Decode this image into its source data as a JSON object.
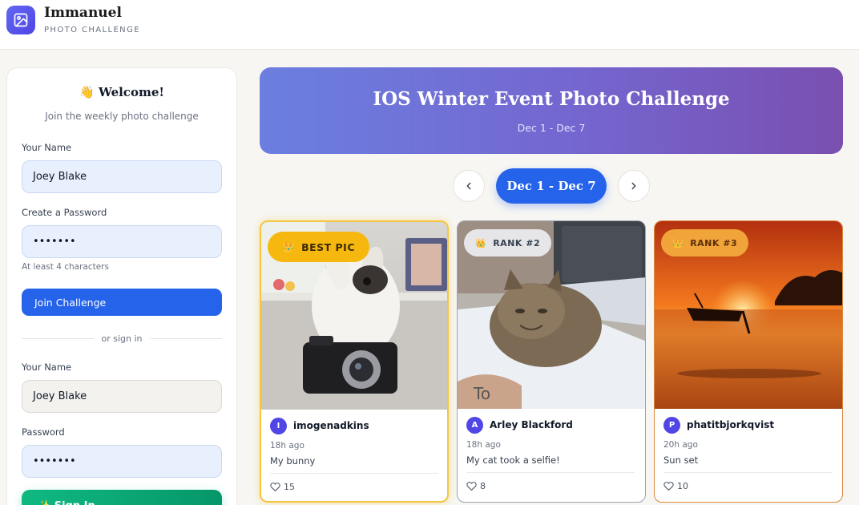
{
  "header": {
    "title": "Immanuel",
    "subtitle": "PHOTO CHALLENGE",
    "logo_icon": "image-icon"
  },
  "sidebar": {
    "welcome": "👋 Welcome!",
    "welcome_sub": "Join the weekly photo challenge",
    "join": {
      "name_label": "Your Name",
      "name_value": "Joey Blake",
      "password_label": "Create a Password",
      "password_value": "•••••••",
      "hint": "At least 4 characters",
      "button": "Join Challenge"
    },
    "divider": "or sign in",
    "signin": {
      "name_label": "Your Name",
      "name_value": "Joey Blake",
      "password_label": "Password",
      "password_value": "•••••••",
      "button": "✨ Sign In"
    }
  },
  "banner": {
    "title": "IOS Winter Event Photo Challenge",
    "dates": "Dec 1 - Dec 7"
  },
  "week_nav": {
    "current": "Dec 1 - Dec 7",
    "prev_icon": "chevron-left-icon",
    "next_icon": "chevron-right-icon"
  },
  "cards": [
    {
      "badge": "BEST PIC",
      "badge_icon": "crown-icon",
      "avatar": "I",
      "user": "imogenadkins",
      "time": "18h ago",
      "caption": "My bunny",
      "likes": "15"
    },
    {
      "badge": "RANK #2",
      "badge_icon": "crown-icon",
      "avatar": "A",
      "user": "Arley Blackford",
      "time": "18h ago",
      "caption": "My cat took a selfie!",
      "likes": "8"
    },
    {
      "badge": "RANK #3",
      "badge_icon": "crown-icon",
      "avatar": "P",
      "user": "phatitbjorkqvist",
      "time": "20h ago",
      "caption": "Sun set",
      "likes": "10"
    }
  ],
  "colors": {
    "primary": "#2563eb",
    "gold": "#f6b80f",
    "success": "#10b981"
  }
}
